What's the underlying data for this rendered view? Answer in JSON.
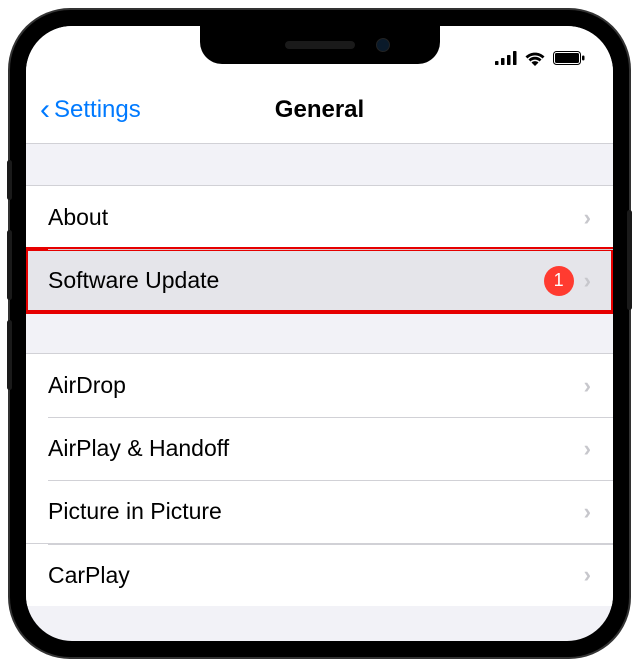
{
  "nav": {
    "back_label": "Settings",
    "title": "General"
  },
  "group1": [
    {
      "label": "About",
      "badge": null,
      "highlight": false
    },
    {
      "label": "Software Update",
      "badge": "1",
      "highlight": true
    }
  ],
  "group2": [
    {
      "label": "AirDrop",
      "badge": null
    },
    {
      "label": "AirPlay & Handoff",
      "badge": null
    },
    {
      "label": "Picture in Picture",
      "badge": null
    },
    {
      "label": "CarPlay",
      "badge": null
    }
  ],
  "colors": {
    "accent": "#007aff",
    "badge": "#ff3b30",
    "highlight_border": "#e60000"
  }
}
